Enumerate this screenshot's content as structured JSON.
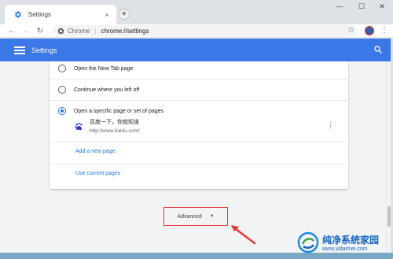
{
  "window": {
    "tab_title": "Settings",
    "tab_close": "×",
    "new_tab": "+",
    "minimize": "—",
    "maximize": "☐",
    "close": "✕"
  },
  "toolbar": {
    "back": "←",
    "forward": "→",
    "reload": "↻",
    "site_label": "Chrome",
    "separator": "|",
    "url": "chrome://settings",
    "star": "☆",
    "menu": "⋮"
  },
  "header": {
    "title": "Settings"
  },
  "startup": {
    "options": [
      {
        "label": "Open the New Tab page",
        "selected": false
      },
      {
        "label": "Continue where you left off",
        "selected": false
      },
      {
        "label": "Open a specific page or set of pages",
        "selected": true
      }
    ],
    "pages": [
      {
        "title": "百度一下，你就知道",
        "url": "http://www.baidu.com/",
        "icon": "baidu-paw-icon"
      }
    ],
    "add_page_link": "Add a new page",
    "use_current_link": "Use current pages",
    "kebab": "⋮"
  },
  "advanced": {
    "label": "Advanced",
    "caret": "▼"
  },
  "watermark": {
    "title": "纯净系统家园",
    "url": "www.yidaimei.com"
  },
  "colors": {
    "header_blue": "#3b78e7",
    "link_blue": "#1a73e8",
    "highlight_red": "#e53935"
  }
}
